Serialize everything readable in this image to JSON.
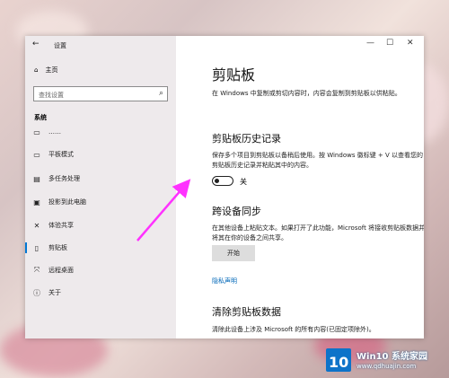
{
  "window": {
    "title": "设置",
    "controls": [
      "—",
      "☐",
      "✕"
    ]
  },
  "sidebar": {
    "home": "主页",
    "search_placeholder": "查找设置",
    "section": "系统",
    "partial_item": "……",
    "items": [
      {
        "label": "平板模式",
        "icon": "tablet-icon"
      },
      {
        "label": "多任务处理",
        "icon": "multitask-icon"
      },
      {
        "label": "投影到此电脑",
        "icon": "project-icon"
      },
      {
        "label": "体验共享",
        "icon": "share-icon"
      },
      {
        "label": "剪贴板",
        "icon": "clipboard-icon"
      },
      {
        "label": "远程桌面",
        "icon": "remote-desktop-icon"
      },
      {
        "label": "关于",
        "icon": "info-icon"
      }
    ]
  },
  "main": {
    "title": "剪贴板",
    "intro": "在 Windows 中复制或剪切内容时，内容会复制到剪贴板以供粘贴。",
    "history": {
      "title": "剪贴板历史记录",
      "desc": "保存多个项目到剪贴板以备稍后使用。按 Windows 徽标键 + V 以查看您的剪贴板历史记录并粘贴其中的内容。",
      "toggle_state": "关"
    },
    "sync": {
      "title": "跨设备同步",
      "desc": "在其他设备上粘贴文本。如果打开了此功能，Microsoft 将接收剪贴板数据并将其在你的设备之间共享。",
      "button": "开始"
    },
    "privacy_link": "隐私声明",
    "clear": {
      "title": "清除剪贴板数据",
      "desc": "清除此设备上涉及 Microsoft 的所有内容(已固定项除外)。"
    }
  },
  "watermark": {
    "brand": "Win10 系统家园",
    "url": "www.qdhuajin.com"
  }
}
